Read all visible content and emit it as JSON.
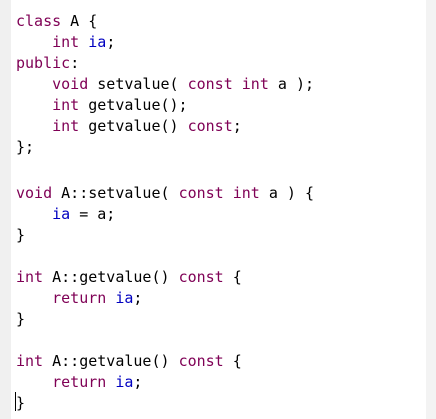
{
  "code_lines": [
    [
      {
        "t": "class",
        "c": "kw"
      },
      {
        "t": " A {",
        "c": "plain"
      }
    ],
    [
      {
        "t": "    ",
        "c": "plain"
      },
      {
        "t": "int",
        "c": "kw"
      },
      {
        "t": " ",
        "c": "plain"
      },
      {
        "t": "ia",
        "c": "field"
      },
      {
        "t": ";",
        "c": "plain"
      }
    ],
    [
      {
        "t": "public",
        "c": "kw"
      },
      {
        "t": ":",
        "c": "plain"
      }
    ],
    [
      {
        "t": "    ",
        "c": "plain"
      },
      {
        "t": "void",
        "c": "kw"
      },
      {
        "t": " setvalue( ",
        "c": "plain"
      },
      {
        "t": "const",
        "c": "kw"
      },
      {
        "t": " ",
        "c": "plain"
      },
      {
        "t": "int",
        "c": "kw"
      },
      {
        "t": " a );",
        "c": "plain"
      }
    ],
    [
      {
        "t": "    ",
        "c": "plain"
      },
      {
        "t": "int",
        "c": "kw"
      },
      {
        "t": " getvalue();",
        "c": "plain"
      }
    ],
    [
      {
        "t": "    ",
        "c": "plain"
      },
      {
        "t": "int",
        "c": "kw"
      },
      {
        "t": " getvalue() ",
        "c": "plain"
      },
      {
        "t": "const",
        "c": "kw"
      },
      {
        "t": ";",
        "c": "plain"
      }
    ],
    [
      {
        "t": "};",
        "c": "plain"
      }
    ],
    [],
    [
      {
        "t": "void",
        "c": "kw"
      },
      {
        "t": " A::setvalue( ",
        "c": "plain"
      },
      {
        "t": "const",
        "c": "kw"
      },
      {
        "t": " ",
        "c": "plain"
      },
      {
        "t": "int",
        "c": "kw"
      },
      {
        "t": " a ) {",
        "c": "plain"
      }
    ],
    [
      {
        "t": "    ",
        "c": "plain"
      },
      {
        "t": "ia",
        "c": "field"
      },
      {
        "t": " = a;",
        "c": "plain"
      }
    ],
    [
      {
        "t": "}",
        "c": "plain"
      }
    ],
    [],
    [
      {
        "t": "int",
        "c": "kw"
      },
      {
        "t": " A::getvalue() ",
        "c": "plain"
      },
      {
        "t": "const",
        "c": "kw"
      },
      {
        "t": " {",
        "c": "plain"
      }
    ],
    [
      {
        "t": "    ",
        "c": "plain"
      },
      {
        "t": "return",
        "c": "kw"
      },
      {
        "t": " ",
        "c": "plain"
      },
      {
        "t": "ia",
        "c": "field"
      },
      {
        "t": ";",
        "c": "plain"
      }
    ],
    [
      {
        "t": "}",
        "c": "plain"
      }
    ],
    [],
    [
      {
        "t": "int",
        "c": "kw"
      },
      {
        "t": " A::getvalue() ",
        "c": "plain"
      },
      {
        "t": "const",
        "c": "kw"
      },
      {
        "t": " {",
        "c": "plain"
      }
    ],
    [
      {
        "t": "    ",
        "c": "plain"
      },
      {
        "t": "return",
        "c": "kw"
      },
      {
        "t": " ",
        "c": "plain"
      },
      {
        "t": "ia",
        "c": "field"
      },
      {
        "t": ";",
        "c": "plain"
      }
    ],
    [
      {
        "t": "}",
        "c": "plain"
      }
    ]
  ],
  "colors": {
    "keyword": "#7f0055",
    "field": "#0000c0",
    "text": "#000000",
    "background": "#ffffff"
  }
}
